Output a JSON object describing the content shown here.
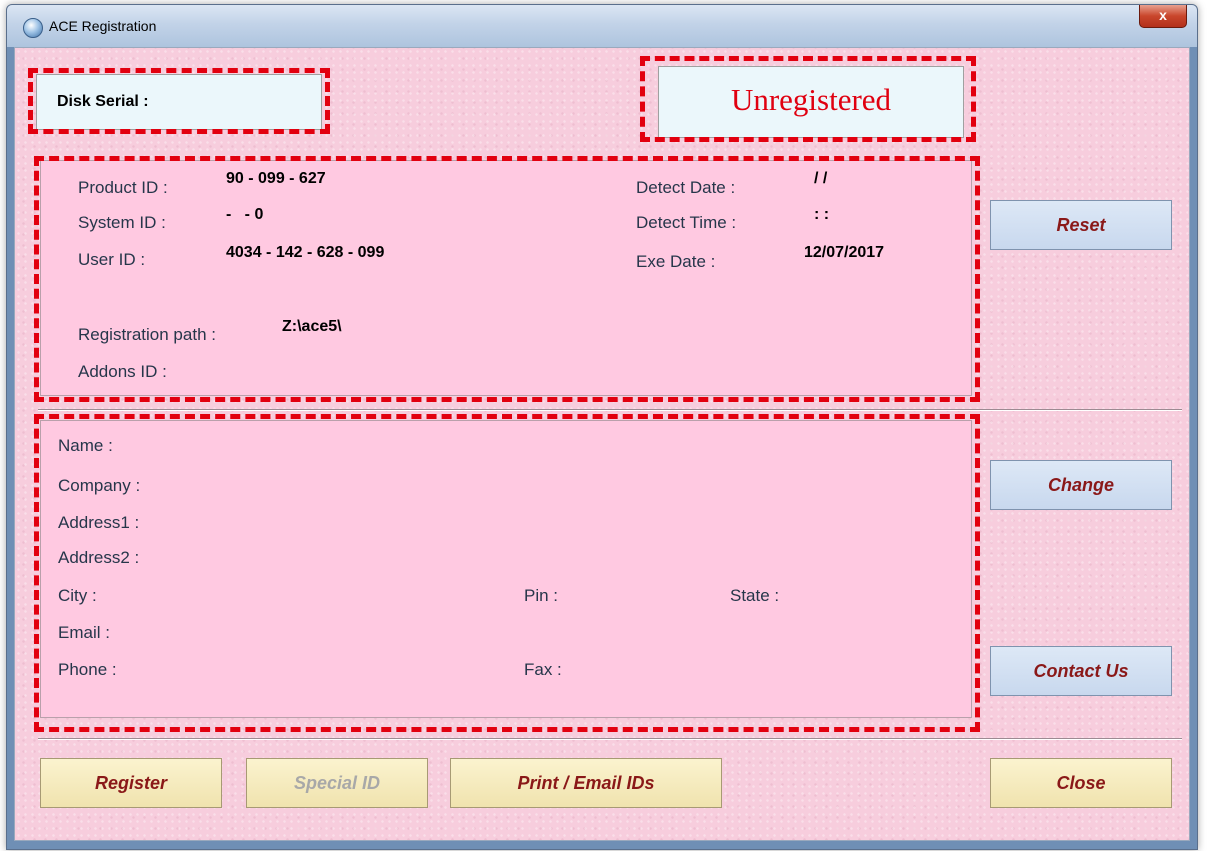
{
  "window": {
    "title": "ACE Registration",
    "close_label": "x"
  },
  "disk_serial": {
    "label": "Disk Serial :",
    "value": ""
  },
  "status": "Unregistered",
  "ids": {
    "product_id_label": "Product ID :",
    "product_id": "90 - 099 - 627",
    "system_id_label": "System ID :",
    "system_id": "-   - 0",
    "user_id_label": "User ID :",
    "user_id": "4034 - 142 - 628 - 099",
    "detect_date_label": "Detect Date :",
    "detect_date": "/ /",
    "detect_time_label": "Detect Time :",
    "detect_time": ": :",
    "exe_date_label": "Exe Date :",
    "exe_date": "12/07/2017",
    "registration_path_label": "Registration path :",
    "registration_path": "Z:\\ace5\\",
    "addons_id_label": "Addons ID :",
    "addons_id": ""
  },
  "contact": {
    "name_label": "Name :",
    "company_label": "Company :",
    "address1_label": "Address1 :",
    "address2_label": "Address2 :",
    "city_label": "City :",
    "pin_label": "Pin :",
    "state_label": "State :",
    "email_label": "Email :",
    "phone_label": "Phone :",
    "fax_label": "Fax :"
  },
  "buttons": {
    "reset": "Reset",
    "change": "Change",
    "contact_us": "Contact Us",
    "register": "Register",
    "special_id": "Special ID",
    "print_email": "Print / Email IDs",
    "close": "Close"
  },
  "colors": {
    "highlight_dash": "#e2000f",
    "panel_pink": "#ffc9e1",
    "button_text": "#8a1818"
  }
}
